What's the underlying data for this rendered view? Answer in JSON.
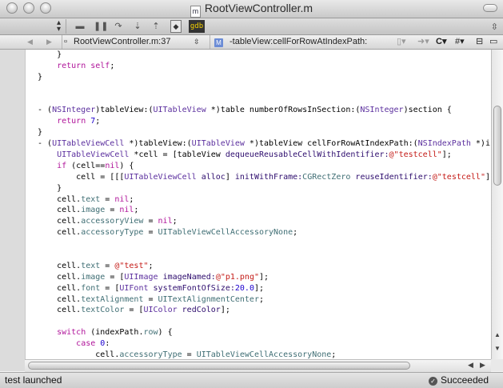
{
  "window": {
    "title": "RootViewController.m",
    "doc_badge": "m"
  },
  "toolbar": {
    "items": [
      {
        "icon": "step-over-icon",
        "glyph": "▬"
      },
      {
        "icon": "pause-icon",
        "glyph": "❚❚"
      },
      {
        "icon": "continue-icon",
        "glyph": "↷"
      },
      {
        "icon": "step-into-icon",
        "glyph": "⇣"
      },
      {
        "icon": "step-out-icon",
        "glyph": "⇡"
      }
    ],
    "breakpoint_glyph": "◆",
    "gdb_label": "gdb"
  },
  "navbar": {
    "back": "◀",
    "forward": "▶",
    "file_position": "RootViewController.m:37",
    "method_badge": "M",
    "method": "-tableView:cellForRowAtIndexPath:",
    "counterpart_label": "C",
    "include_label": "#"
  },
  "code_lines": [
    [
      {
        "t": "    }"
      }
    ],
    [
      {
        "t": "    "
      },
      {
        "t": "return",
        "c": "kw"
      },
      {
        "t": " "
      },
      {
        "t": "self",
        "c": "kw"
      },
      {
        "t": ";"
      }
    ],
    [
      {
        "t": "}"
      }
    ],
    [
      {
        "t": ""
      }
    ],
    [
      {
        "t": ""
      }
    ],
    [
      {
        "t": "- ("
      },
      {
        "t": "NSInteger",
        "c": "ty"
      },
      {
        "t": ")tableView:("
      },
      {
        "t": "UITableView",
        "c": "ty"
      },
      {
        "t": " *)table numberOfRowsInSection:("
      },
      {
        "t": "NSInteger",
        "c": "ty"
      },
      {
        "t": ")section {"
      }
    ],
    [
      {
        "t": "    "
      },
      {
        "t": "return",
        "c": "kw"
      },
      {
        "t": " "
      },
      {
        "t": "7",
        "c": "nm"
      },
      {
        "t": ";"
      }
    ],
    [
      {
        "t": "}"
      }
    ],
    [
      {
        "t": "- ("
      },
      {
        "t": "UITableViewCell",
        "c": "ty"
      },
      {
        "t": " *)tableView:("
      },
      {
        "t": "UITableView",
        "c": "ty"
      },
      {
        "t": " *)tableView cellForRowAtIndexPath:("
      },
      {
        "t": "NSIndexPath",
        "c": "ty"
      },
      {
        "t": " *)i"
      }
    ],
    [
      {
        "t": "    "
      },
      {
        "t": "UITableViewCell",
        "c": "ty"
      },
      {
        "t": " *cell = [tableView "
      },
      {
        "t": "dequeueReusableCellWithIdentifier:",
        "c": "me"
      },
      {
        "t": "@\"testcell\"",
        "c": "st"
      },
      {
        "t": "];"
      }
    ],
    [
      {
        "t": "    "
      },
      {
        "t": "if",
        "c": "kw"
      },
      {
        "t": " (cell=="
      },
      {
        "t": "nil",
        "c": "kw"
      },
      {
        "t": ") {"
      }
    ],
    [
      {
        "t": "        cell = [[["
      },
      {
        "t": "UITableViewCell",
        "c": "ty"
      },
      {
        "t": " "
      },
      {
        "t": "alloc",
        "c": "me"
      },
      {
        "t": "] "
      },
      {
        "t": "initWithFrame:",
        "c": "me"
      },
      {
        "t": "CGRectZero",
        "c": "mp"
      },
      {
        "t": " "
      },
      {
        "t": "reuseIdentifier:",
        "c": "me"
      },
      {
        "t": "@\"testcell\"",
        "c": "st"
      },
      {
        "t": "]"
      }
    ],
    [
      {
        "t": "    }"
      }
    ],
    [
      {
        "t": "    cell."
      },
      {
        "t": "text",
        "c": "mp"
      },
      {
        "t": " = "
      },
      {
        "t": "nil",
        "c": "kw"
      },
      {
        "t": ";"
      }
    ],
    [
      {
        "t": "    cell."
      },
      {
        "t": "image",
        "c": "mp"
      },
      {
        "t": " = "
      },
      {
        "t": "nil",
        "c": "kw"
      },
      {
        "t": ";"
      }
    ],
    [
      {
        "t": "    cell."
      },
      {
        "t": "accessoryView",
        "c": "mp"
      },
      {
        "t": " = "
      },
      {
        "t": "nil",
        "c": "kw"
      },
      {
        "t": ";"
      }
    ],
    [
      {
        "t": "    cell."
      },
      {
        "t": "accessoryType",
        "c": "mp"
      },
      {
        "t": " = "
      },
      {
        "t": "UITableViewCellAccessoryNone",
        "c": "mp"
      },
      {
        "t": ";"
      }
    ],
    [
      {
        "t": ""
      }
    ],
    [
      {
        "t": ""
      }
    ],
    [
      {
        "t": "    cell."
      },
      {
        "t": "text",
        "c": "mp"
      },
      {
        "t": " = "
      },
      {
        "t": "@\"test\"",
        "c": "st"
      },
      {
        "t": ";"
      }
    ],
    [
      {
        "t": "    cell."
      },
      {
        "t": "image",
        "c": "mp"
      },
      {
        "t": " = ["
      },
      {
        "t": "UIImage",
        "c": "ty"
      },
      {
        "t": " "
      },
      {
        "t": "imageNamed:",
        "c": "me"
      },
      {
        "t": "@\"p1.png\"",
        "c": "st"
      },
      {
        "t": "];"
      }
    ],
    [
      {
        "t": "    cell."
      },
      {
        "t": "font",
        "c": "mp"
      },
      {
        "t": " = ["
      },
      {
        "t": "UIFont",
        "c": "ty"
      },
      {
        "t": " "
      },
      {
        "t": "systemFontOfSize:",
        "c": "me"
      },
      {
        "t": "20.0",
        "c": "nm"
      },
      {
        "t": "];"
      }
    ],
    [
      {
        "t": "    cell."
      },
      {
        "t": "textAlignment",
        "c": "mp"
      },
      {
        "t": " = "
      },
      {
        "t": "UITextAlignmentCenter",
        "c": "mp"
      },
      {
        "t": ";"
      }
    ],
    [
      {
        "t": "    cell."
      },
      {
        "t": "textColor",
        "c": "mp"
      },
      {
        "t": " = ["
      },
      {
        "t": "UIColor",
        "c": "ty"
      },
      {
        "t": " "
      },
      {
        "t": "redColor",
        "c": "me"
      },
      {
        "t": "];"
      }
    ],
    [
      {
        "t": ""
      }
    ],
    [
      {
        "t": "    "
      },
      {
        "t": "switch",
        "c": "kw"
      },
      {
        "t": " (indexPath."
      },
      {
        "t": "row",
        "c": "mp"
      },
      {
        "t": ") {"
      }
    ],
    [
      {
        "t": "        "
      },
      {
        "t": "case",
        "c": "kw"
      },
      {
        "t": " "
      },
      {
        "t": "0",
        "c": "nm"
      },
      {
        "t": ":"
      }
    ],
    [
      {
        "t": "            cell."
      },
      {
        "t": "accessoryType",
        "c": "mp"
      },
      {
        "t": " = "
      },
      {
        "t": "UITableViewCellAccessoryNone",
        "c": "mp"
      },
      {
        "t": ";"
      }
    ]
  ],
  "status": {
    "left": "test launched",
    "right": "Succeeded"
  }
}
